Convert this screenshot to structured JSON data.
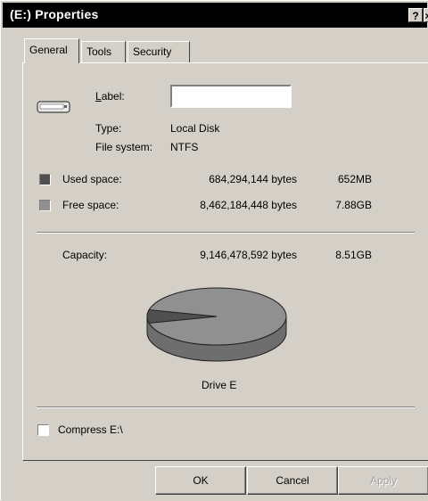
{
  "window": {
    "title": "(E:) Properties",
    "help_glyph": "?",
    "close_glyph": "×"
  },
  "tabs": [
    {
      "label": "General",
      "active": true
    },
    {
      "label": "Tools",
      "active": false
    },
    {
      "label": "Security",
      "active": false
    }
  ],
  "general": {
    "drive_icon": "drive-icon",
    "label_field": {
      "label": "Label:",
      "value": ""
    },
    "type": {
      "label": "Type:",
      "value": "Local Disk"
    },
    "file_system": {
      "label": "File system:",
      "value": "NTFS"
    },
    "used_space": {
      "label": "Used space:",
      "bytes": "684,294,144 bytes",
      "size": "652MB",
      "color": "#505050"
    },
    "free_space": {
      "label": "Free space:",
      "bytes": "8,462,184,448 bytes",
      "size": "7.88GB",
      "color": "#909090"
    },
    "capacity": {
      "label": "Capacity:",
      "bytes": "9,146,478,592 bytes",
      "size": "8.51GB"
    },
    "used_fraction": 0.0748,
    "drive_caption": "Drive E",
    "compress": {
      "label": "Compress E:\\",
      "checked": false
    }
  },
  "buttons": {
    "ok": "OK",
    "cancel": "Cancel",
    "apply": "Apply"
  }
}
